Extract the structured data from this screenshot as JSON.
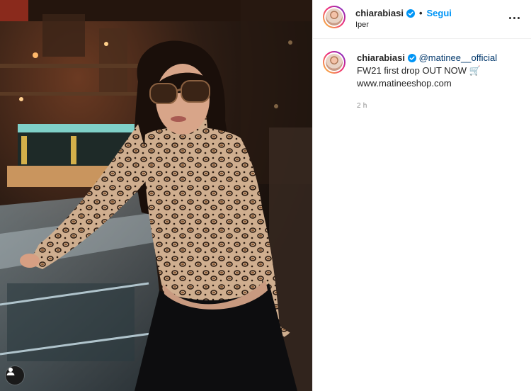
{
  "post": {
    "photo_alt": "",
    "author": {
      "username": "chiarabiasi",
      "verified": true,
      "follow_label": "Segui",
      "separator": "•",
      "location": "Iper"
    },
    "caption": {
      "username": "chiarabiasi",
      "mention": "@matinee__official",
      "line1": "FW21 first drop OUT NOW 🛒",
      "line2": "www.matineeshop.com",
      "timestamp": "2 h"
    }
  },
  "icons": {
    "verified": "verified-badge-icon",
    "more": "more-options-icon",
    "user_tag": "user-tag-icon"
  },
  "colors": {
    "link_blue": "#0095f6",
    "mention_blue": "#00376b",
    "text": "#262626",
    "muted": "#8e8e8e"
  }
}
